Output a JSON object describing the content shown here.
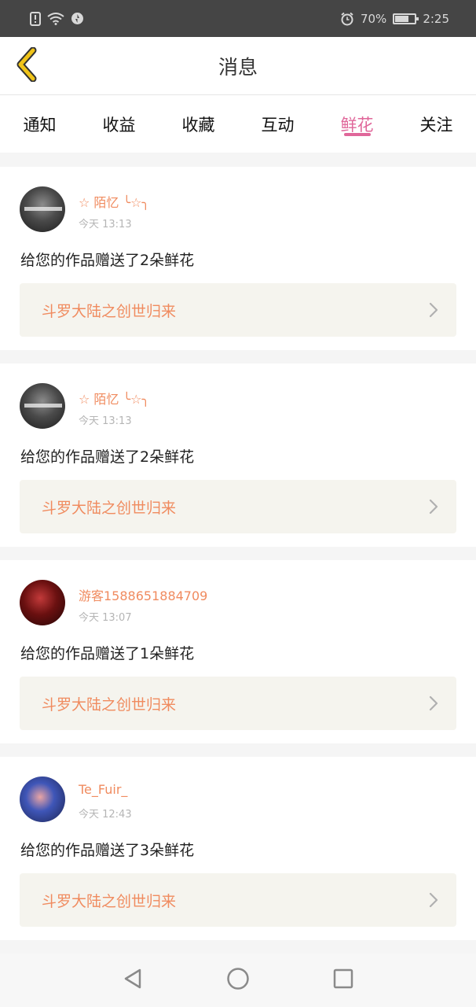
{
  "status_bar": {
    "battery": "70%",
    "battery_level": 0.7,
    "time": "2:25",
    "icons": [
      "sim-alert-icon",
      "wifi-icon",
      "data-saver-icon",
      "alarm-icon",
      "battery-icon"
    ]
  },
  "header": {
    "title": "消息",
    "back_icon": "chevron-left-icon",
    "accent": "#f0c419"
  },
  "tabs": [
    {
      "label": "通知",
      "active": false
    },
    {
      "label": "收益",
      "active": false
    },
    {
      "label": "收藏",
      "active": false
    },
    {
      "label": "互动",
      "active": false
    },
    {
      "label": "鲜花",
      "active": true
    },
    {
      "label": "关注",
      "active": false
    }
  ],
  "colors": {
    "active_tab": "#e0679a",
    "username": "#f08b5f",
    "work_title": "#f08b5f",
    "link_bg": "#f5f4ee"
  },
  "notifications": [
    {
      "username": "☆ 陌忆 ╰☆╮",
      "time": "今天 13:13",
      "message": "给您的作品赠送了2朵鲜花",
      "work_title": "斗罗大陆之创世归来"
    },
    {
      "username": "☆ 陌忆 ╰☆╮",
      "time": "今天 13:13",
      "message": "给您的作品赠送了2朵鲜花",
      "work_title": "斗罗大陆之创世归来"
    },
    {
      "username": "游客1588651884709",
      "time": "今天 13:07",
      "message": "给您的作品赠送了1朵鲜花",
      "work_title": "斗罗大陆之创世归来"
    },
    {
      "username": "Te_Fuir_",
      "time": "今天 12:43",
      "message": "给您的作品赠送了3朵鲜花",
      "work_title": "斗罗大陆之创世归来"
    }
  ],
  "nav_bar": {
    "icons": [
      "back-triangle-icon",
      "home-circle-icon",
      "recents-square-icon"
    ]
  }
}
